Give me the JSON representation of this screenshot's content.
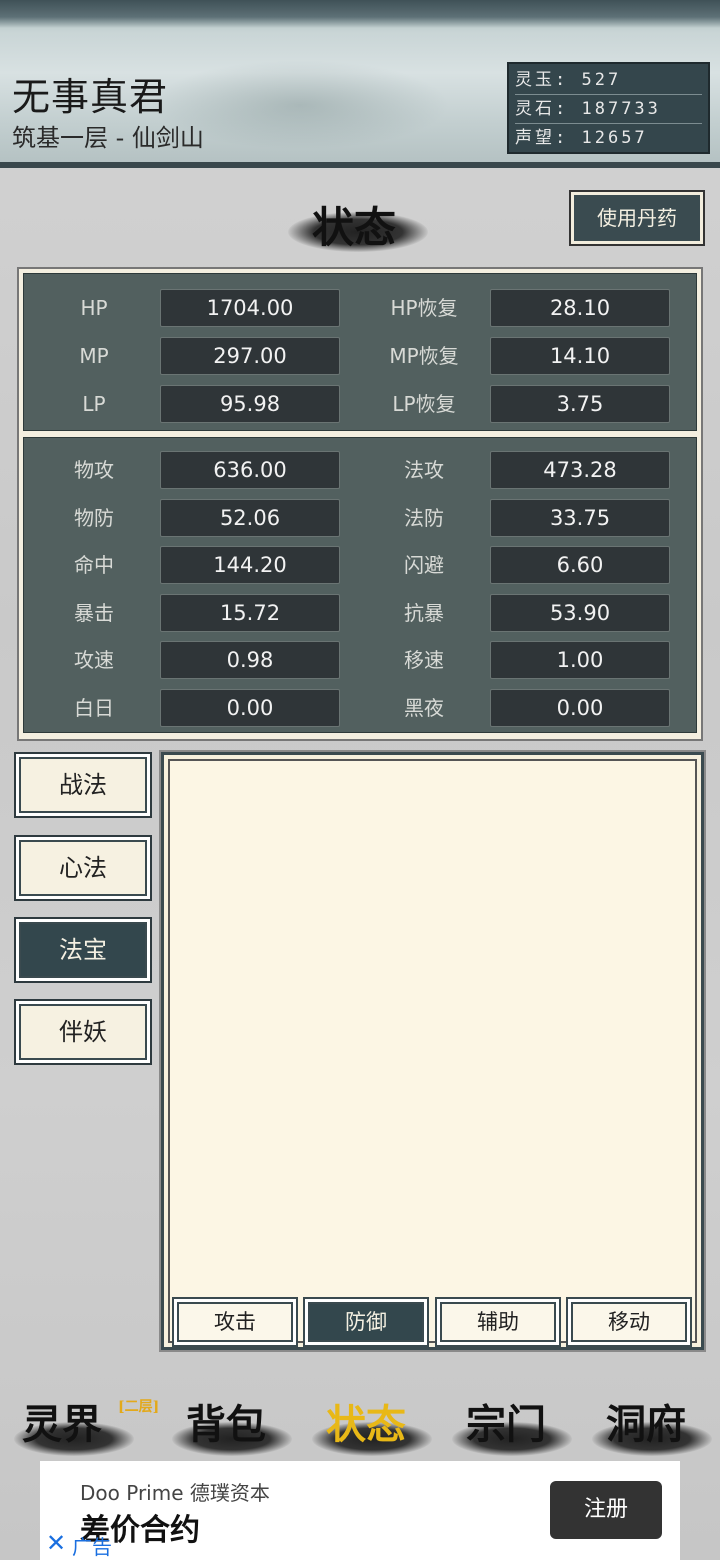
{
  "header": {
    "character_name": "无事真君",
    "realm": "筑基一层 - 仙剑山",
    "resources": [
      {
        "label": "灵玉",
        "value": "527"
      },
      {
        "label": "灵石",
        "value": "187733"
      },
      {
        "label": "声望",
        "value": "12657"
      }
    ]
  },
  "section": {
    "title": "状态",
    "use_pill_label": "使用丹药"
  },
  "stats": {
    "vital": [
      {
        "label": "HP",
        "value": "1704.00",
        "label2": "HP恢复",
        "value2": "28.10"
      },
      {
        "label": "MP",
        "value": "297.00",
        "label2": "MP恢复",
        "value2": "14.10"
      },
      {
        "label": "LP",
        "value": "95.98",
        "label2": "LP恢复",
        "value2": "3.75"
      }
    ],
    "combat": [
      {
        "label": "物攻",
        "value": "636.00",
        "label2": "法攻",
        "value2": "473.28"
      },
      {
        "label": "物防",
        "value": "52.06",
        "label2": "法防",
        "value2": "33.75"
      },
      {
        "label": "命中",
        "value": "144.20",
        "label2": "闪避",
        "value2": "6.60"
      },
      {
        "label": "暴击",
        "value": "15.72",
        "label2": "抗暴",
        "value2": "53.90"
      },
      {
        "label": "攻速",
        "value": "0.98",
        "label2": "移速",
        "value2": "1.00"
      },
      {
        "label": "白日",
        "value": "0.00",
        "label2": "黑夜",
        "value2": "0.00"
      }
    ]
  },
  "side_tabs": [
    {
      "label": "战法",
      "active": false
    },
    {
      "label": "心法",
      "active": false
    },
    {
      "label": "法宝",
      "active": true
    },
    {
      "label": "伴妖",
      "active": false
    }
  ],
  "skill_tabs": [
    {
      "label": "攻击",
      "active": false
    },
    {
      "label": "防御",
      "active": true
    },
    {
      "label": "辅助",
      "active": false
    },
    {
      "label": "移动",
      "active": false
    }
  ],
  "nav": {
    "items": [
      {
        "label": "灵界",
        "sup": "[二层]"
      },
      {
        "label": "背包"
      },
      {
        "label": "状态",
        "active": true
      },
      {
        "label": "宗门"
      },
      {
        "label": "洞府"
      }
    ]
  },
  "ad": {
    "brand": "Doo Prime 德璞资本",
    "title": "差价合约",
    "button": "注册",
    "tag": "广告",
    "close": "✕"
  },
  "colors": {
    "accent_active": "#e8b817",
    "panel_dark": "#33474d",
    "panel_light": "#fcf6e4"
  }
}
